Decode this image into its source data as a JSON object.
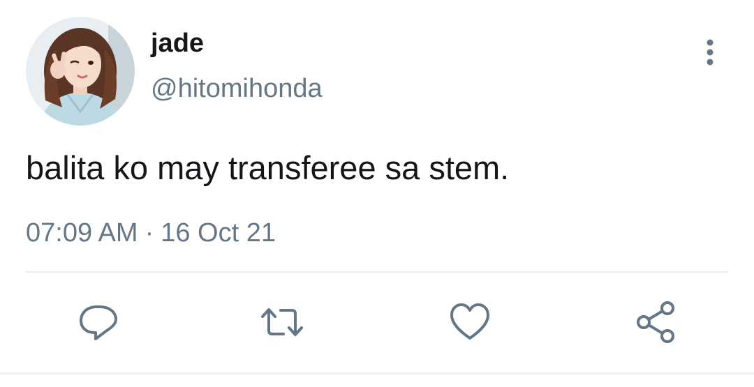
{
  "user": {
    "display_name": "jade",
    "handle": "@hitomihonda",
    "avatar": "profile-photo"
  },
  "tweet": {
    "text": "balita ko may transferee sa stem.",
    "time": "07:09 AM",
    "separator": "·",
    "date": "16 Oct 21"
  },
  "actions": [
    {
      "icon": "reply-icon"
    },
    {
      "icon": "retweet-icon"
    },
    {
      "icon": "like-icon"
    },
    {
      "icon": "share-icon"
    }
  ],
  "colors": {
    "text": "#14171a",
    "secondary": "#657786",
    "divider": "#e6ecf0",
    "icon": "#657786"
  }
}
